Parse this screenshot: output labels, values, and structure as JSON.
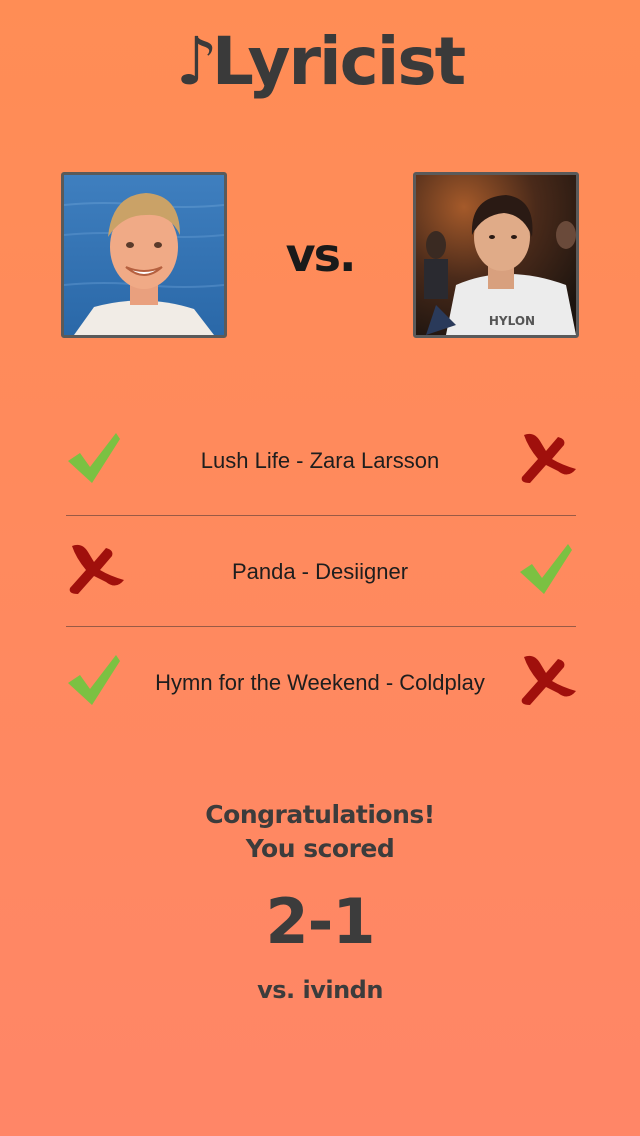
{
  "app": {
    "logo_glyph": "♪",
    "logo_text": "Lyricist"
  },
  "match": {
    "player_left_avatar": "player-photo",
    "player_right_avatar": "opponent-photo",
    "vs_label": "vs."
  },
  "rounds": [
    {
      "song": "Lush Life - Zara Larsson",
      "left_result": "check",
      "right_result": "cross"
    },
    {
      "song": "Panda - Desiigner",
      "left_result": "cross",
      "right_result": "check"
    },
    {
      "song": "Hymn for the Weekend - Coldplay",
      "left_result": "check",
      "right_result": "cross"
    }
  ],
  "result": {
    "line1": "Congratulations!",
    "line2": "You scored",
    "score": "2-1",
    "opponent": "vs. ivindn"
  },
  "colors": {
    "background_top": "#ff8d55",
    "background_bottom": "#ff8667",
    "check": "#7bc142",
    "cross": "#a0100c",
    "text_dark": "#3c3c3c"
  }
}
